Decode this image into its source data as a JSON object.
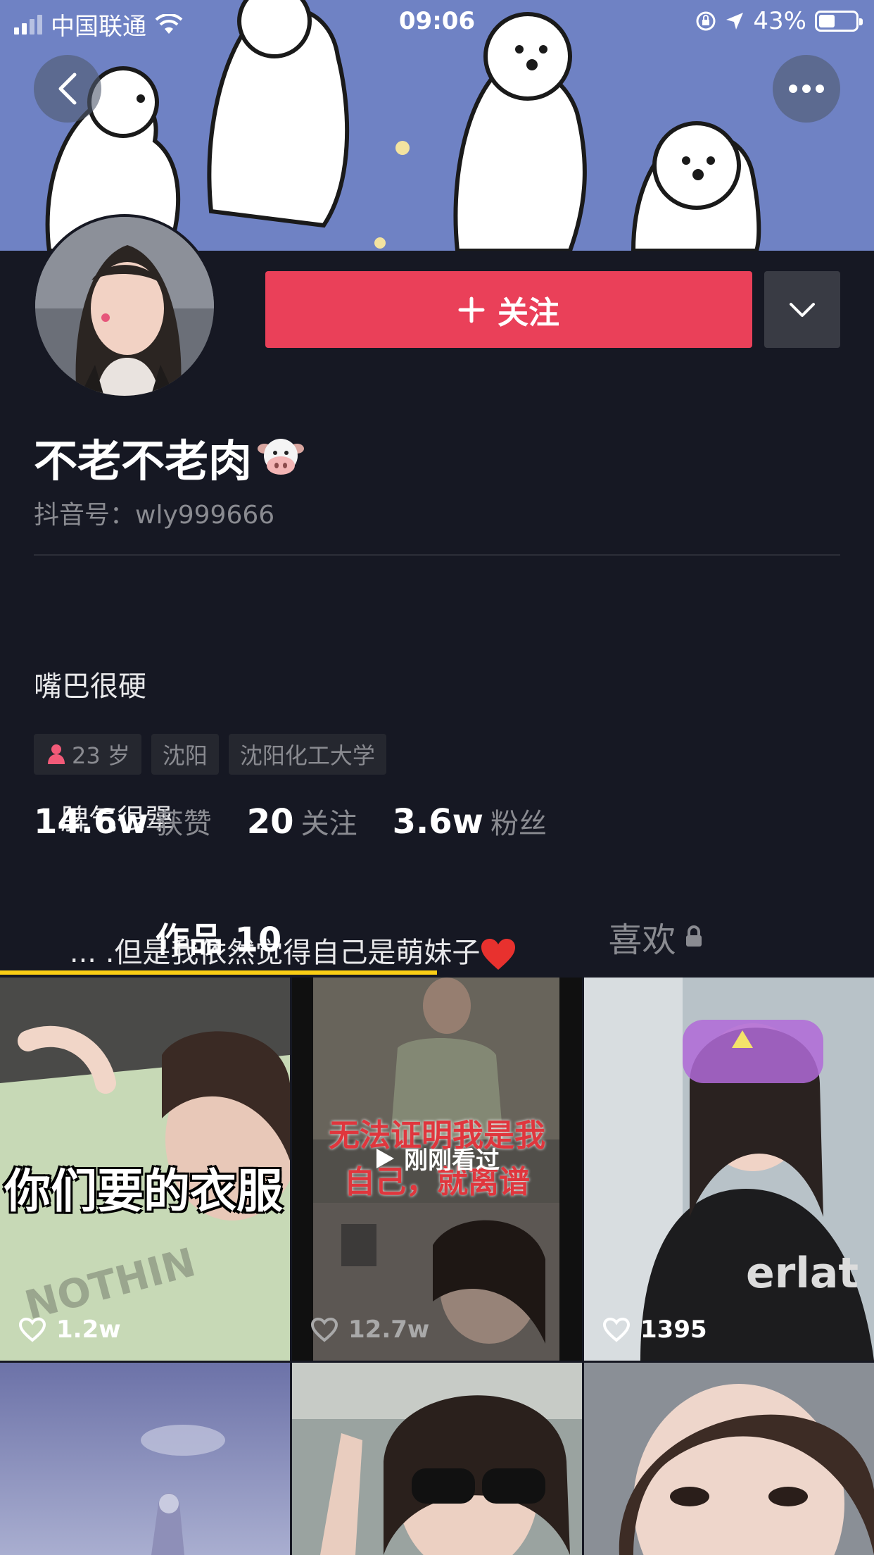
{
  "status_bar": {
    "carrier": "中国联通",
    "time": "09:06",
    "battery": "43%",
    "battery_level": 0.43
  },
  "profile": {
    "follow_label": "关注",
    "nickname": "不老不老肉",
    "douyin_id": "抖音号：wly999666",
    "bio_line1": "嘴巴很硬",
    "bio_line2": "   脾气很犟",
    "bio_line3": "    ... .但是我依然觉得自己是萌妹子",
    "tags": [
      {
        "label": "23 岁",
        "icon": "female-icon"
      },
      {
        "label": "沈阳"
      },
      {
        "label": "沈阳化工大学"
      }
    ],
    "stats": [
      {
        "value": "14.6w",
        "label": "获赞"
      },
      {
        "value": "20",
        "label": "关注"
      },
      {
        "value": "3.6w",
        "label": "粉丝"
      }
    ]
  },
  "tabs": {
    "works": "作品 10",
    "likes": "喜欢"
  },
  "videos": [
    {
      "likes": "1.2w",
      "caption": "你们要的衣服"
    },
    {
      "likes": "12.7w",
      "caption_line1": "无法证明我是我",
      "caption_line2": "自己，就离谱",
      "overlay": "刚刚看过"
    },
    {
      "likes": "1395"
    },
    {},
    {},
    {}
  ],
  "colors": {
    "background": "#161823",
    "follow_button": "#ea4059",
    "tab_indicator": "#face15",
    "banner": "#6f82c4"
  }
}
